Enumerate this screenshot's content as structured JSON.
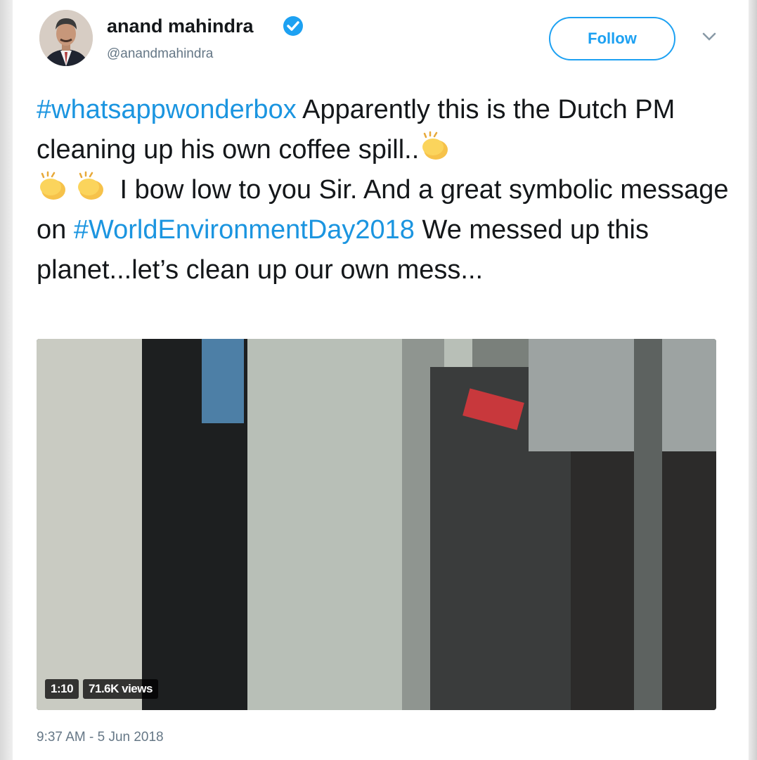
{
  "tweet": {
    "author_name": "anand mahindra",
    "handle": "@anandmahindra",
    "follow_label": "Follow",
    "text": {
      "hashtag1": "#whatsappwonderbox",
      "part1": " Apparently this is the Dutch PM cleaning up his own coffee spill..",
      "part2": " I bow low to you Sir. And a great symbolic message on ",
      "hashtag2": "#WorldEnvironmentDay2018",
      "part3": " We messed up this planet...let’s clean up our own mess..."
    },
    "emoji": "clapping-hands",
    "video": {
      "duration": "1:10",
      "views": "71.6K views"
    },
    "timestamp": "9:37 AM - 5 Jun 2018"
  },
  "colors": {
    "link": "#1b95e0",
    "follow": "#1da1f2",
    "meta": "#657786",
    "text": "#14171a"
  }
}
